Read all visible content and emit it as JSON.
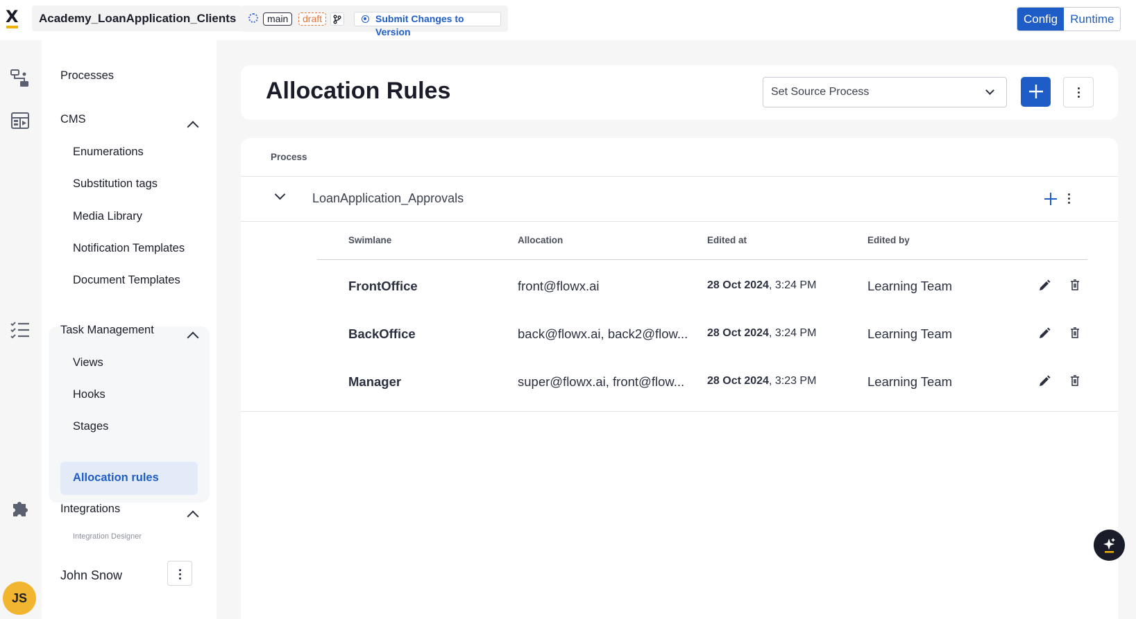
{
  "topbar": {
    "logo": "X",
    "app_name": "Academy_LoanApplication_Clients",
    "branch": "main",
    "status": "draft",
    "branch_icon": "git-branch-icon",
    "submit_label": "Submit Changes to Version",
    "mode_config": "Config",
    "mode_runtime": "Runtime"
  },
  "rail": {
    "icons": [
      "process-flow-icon",
      "cms-icon",
      "task-list-icon",
      "puzzle-icon"
    ],
    "avatar_initials": "JS"
  },
  "sidebar": {
    "processes": "Processes",
    "cms": {
      "label": "CMS",
      "items": [
        "Enumerations",
        "Substitution tags",
        "Media Library",
        "Notification Templates",
        "Document Templates"
      ]
    },
    "task_management": {
      "label": "Task Management",
      "items": [
        "Views",
        "Hooks",
        "Stages",
        "Allocation rules"
      ],
      "active": "Allocation rules"
    },
    "integrations": {
      "label": "Integrations",
      "items": [
        "Integration Designer"
      ]
    },
    "user_name": "John Snow"
  },
  "header": {
    "title": "Allocation Rules",
    "source_placeholder": "Set Source Process"
  },
  "table": {
    "process_header": "Process",
    "process_name": "LoanApplication_Approvals",
    "columns": [
      "Swimlane",
      "Allocation",
      "Edited at",
      "Edited by"
    ],
    "rows": [
      {
        "swimlane": "FrontOffice",
        "allocation": "front@flowx.ai",
        "date": "28 Oct 2024",
        "time": ", 3:24 PM",
        "edited_by": "Learning Team"
      },
      {
        "swimlane": "BackOffice",
        "allocation": "back@flowx.ai, back2@flow...",
        "date": "28 Oct 2024",
        "time": ", 3:24 PM",
        "edited_by": "Learning Team"
      },
      {
        "swimlane": "Manager",
        "allocation": "super@flowx.ai, front@flow...",
        "date": "28 Oct 2024",
        "time": ", 3:23 PM",
        "edited_by": "Learning Team"
      }
    ]
  },
  "colors": {
    "accent": "#1e5dc8",
    "active_bg": "#e3ebf9",
    "avatar": "#f2b52f",
    "draft": "#e8733a"
  }
}
